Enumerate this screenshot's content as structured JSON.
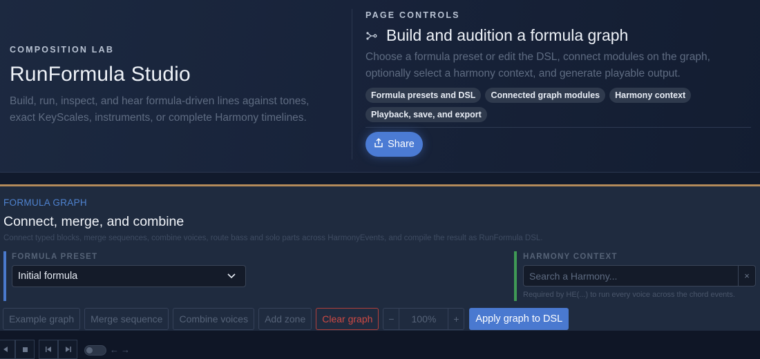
{
  "hero": {
    "eyebrow": "COMPOSITION LAB",
    "title": "RunFormula Studio",
    "description": "Build, run, inspect, and hear formula-driven lines against tones, exact KeyScales, instruments, or complete Harmony timelines."
  },
  "page_controls": {
    "eyebrow": "PAGE CONTROLS",
    "title_icon": "graph-nodes-icon",
    "title": "Build and audition a formula graph",
    "description": "Choose a formula preset or edit the DSL, connect modules on the graph, optionally select a harmony context, and generate playable output.",
    "chips": [
      "Formula presets and DSL",
      "Connected graph modules",
      "Harmony context",
      "Playback, save, and export"
    ],
    "share_icon": "share-icon",
    "share_label": "Share"
  },
  "formula_graph": {
    "eyebrow": "FORMULA GRAPH",
    "title": "Connect, merge, and combine",
    "description": "Connect typed blocks, merge sequences, combine voices, route bass and solo parts across HarmonyEvents, and compile the result as RunFormula DSL.",
    "preset_label": "FORMULA PRESET",
    "preset_value": "Initial formula",
    "harmony_label": "HARMONY CONTEXT",
    "harmony_placeholder": "Search a Harmony...",
    "harmony_clear": "×",
    "harmony_hint": "Required by HE(...) to run every voice across the chord events.",
    "toolbar": {
      "example": "Example graph",
      "merge": "Merge sequence",
      "combine": "Combine voices",
      "add_zone": "Add zone",
      "clear": "Clear graph",
      "zoom_out": "−",
      "zoom": "100%",
      "zoom_in": "+",
      "apply": "Apply graph to DSL"
    }
  },
  "transport": {
    "back_arrow": "←",
    "forward_arrow": "→"
  },
  "colors": {
    "accent_blue": "#4b7bd4",
    "danger_red": "#d04a44",
    "harmony_green": "#3f9a55",
    "divider_gold": "#b38a5a"
  }
}
